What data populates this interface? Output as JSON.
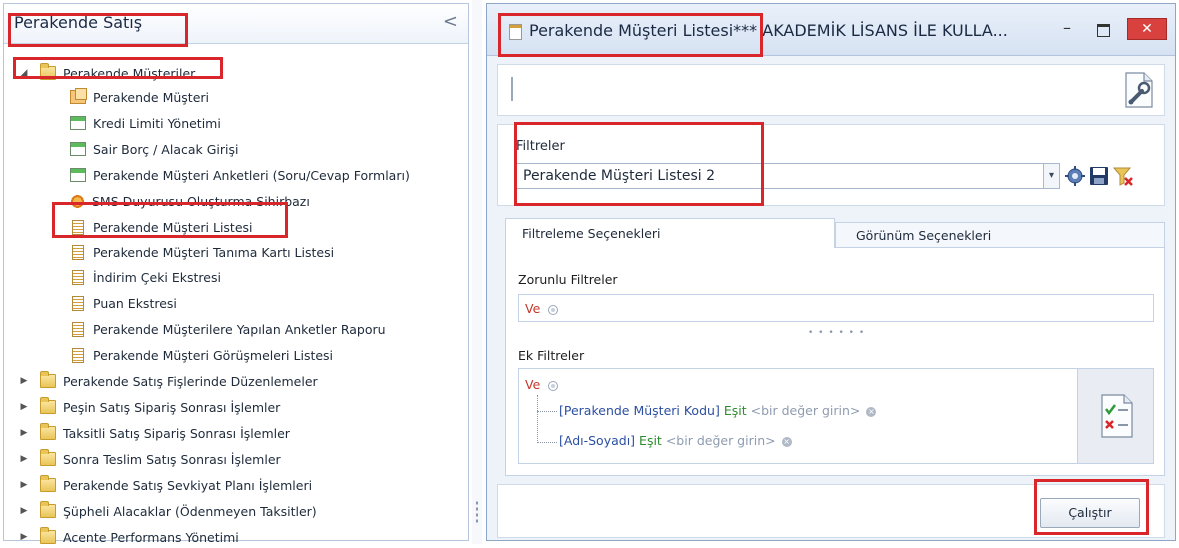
{
  "left_panel": {
    "title": "Perakende Satış",
    "collapse_glyph": "<",
    "tree": [
      {
        "label": "Perakende Müşteriler",
        "icon": "folder-icon",
        "expanded": true
      },
      {
        "label": "Perakende Müşteri",
        "icon": "multi-card-icon"
      },
      {
        "label": "Kredi Limiti Yönetimi",
        "icon": "form-icon"
      },
      {
        "label": "Sair Borç / Alacak Girişi",
        "icon": "form-icon"
      },
      {
        "label": "Perakende Müşteri Anketleri (Soru/Cevap Formları)",
        "icon": "form-icon"
      },
      {
        "label": "SMS Duyurusu Oluşturma Sihirbazı",
        "icon": "wizard-icon"
      },
      {
        "label": "Perakende Müşteri Listesi",
        "icon": "list-report-icon"
      },
      {
        "label": "Perakende Müşteri Tanıma Kartı Listesi",
        "icon": "list-report-icon"
      },
      {
        "label": "İndirim Çeki Ekstresi",
        "icon": "list-report-icon"
      },
      {
        "label": "Puan Ekstresi",
        "icon": "list-report-icon"
      },
      {
        "label": "Perakende Müşterilere Yapılan  Anketler Raporu",
        "icon": "list-report-icon"
      },
      {
        "label": "Perakende Müşteri Görüşmeleri Listesi",
        "icon": "list-report-icon"
      },
      {
        "label": "Perakende Satış Fişlerinde Düzenlemeler",
        "icon": "folder-icon"
      },
      {
        "label": "Peşin Satış Sipariş Sonrası İşlemler",
        "icon": "folder-icon"
      },
      {
        "label": "Taksitli Satış Sipariş Sonrası İşlemler",
        "icon": "folder-icon"
      },
      {
        "label": "Sonra Teslim Satış Sonrası İşlemler",
        "icon": "folder-icon"
      },
      {
        "label": "Perakende Satış Sevkiyat Planı İşlemleri",
        "icon": "folder-icon"
      },
      {
        "label": "Şüpheli Alacaklar (Ödenmeyen Taksitler)",
        "icon": "folder-icon"
      },
      {
        "label": "Acente Performans Yönetimi",
        "icon": "folder-icon"
      }
    ]
  },
  "window": {
    "title": "Perakende Müşteri Listesi*** AKADEMİK LİSANS İLE KULLA...",
    "minimize_glyph": "–",
    "close_glyph": "✕"
  },
  "filters": {
    "label": "Filtreler",
    "selected": "Perakende Müşteri Listesi 2",
    "dropdown_glyph": "▾"
  },
  "tabs": {
    "filter_options": "Filtreleme Seçenekleri",
    "view_options": "Görünüm Seçenekleri"
  },
  "mandatory": {
    "label": "Zorunlu Filtreler",
    "and_word": "Ve"
  },
  "splitter_dots": "• • • • • •",
  "extra": {
    "label": "Ek Filtreler",
    "and_word": "Ve",
    "conditions": [
      {
        "field": "[Perakende Müşteri Kodu]",
        "op": "Eşit",
        "value": "<bir değer girin>"
      },
      {
        "field": "[Adı-Soyadı]",
        "op": "Eşit",
        "value": "<bir değer girin>"
      }
    ]
  },
  "run_button": "Çalıştır",
  "colors": {
    "highlight_red": "#d8262b",
    "close_red": "#d9413f",
    "field_blue": "#2c4fa1",
    "operator_green": "#2e8b2e",
    "and_red": "#c0392b"
  }
}
